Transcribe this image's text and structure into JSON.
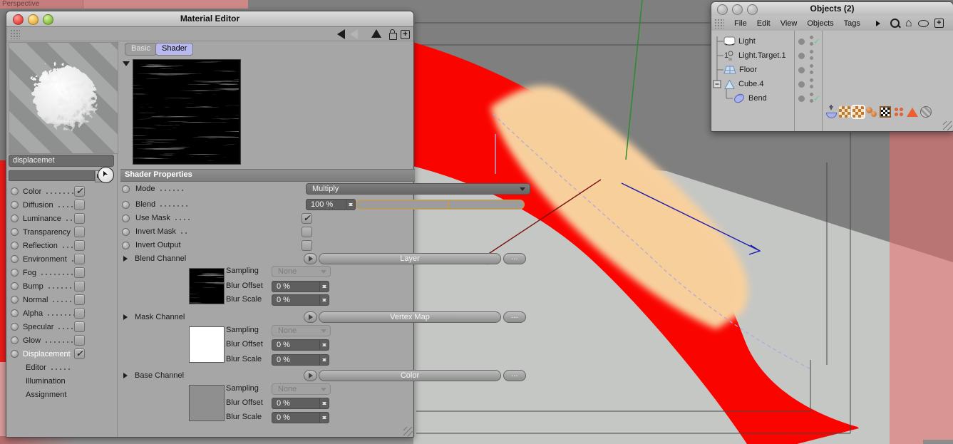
{
  "viewport": {
    "label": "Perspective",
    "scene_colors": {
      "band": "#fa0400",
      "band_highlight": "#f7cf9b",
      "axis_green": "#2f8a2f",
      "axis_red": "#7a1111",
      "axis_blue": "#1c1cae",
      "overlay_pink": "#e96c6c"
    }
  },
  "material_editor": {
    "title": "Material Editor",
    "name_value": "displacemet",
    "tabs": {
      "basic": "Basic",
      "shader": "Shader"
    },
    "channels": [
      {
        "label": "Color",
        "checked": true
      },
      {
        "label": "Diffusion",
        "checked": false
      },
      {
        "label": "Luminance",
        "checked": false
      },
      {
        "label": "Transparency",
        "checked": false
      },
      {
        "label": "Reflection",
        "checked": false
      },
      {
        "label": "Environment",
        "checked": false
      },
      {
        "label": "Fog",
        "checked": false
      },
      {
        "label": "Bump",
        "checked": false
      },
      {
        "label": "Normal",
        "checked": false
      },
      {
        "label": "Alpha",
        "checked": false
      },
      {
        "label": "Specular",
        "checked": false
      },
      {
        "label": "Glow",
        "checked": false
      },
      {
        "label": "Displacement",
        "checked": true,
        "selected": true
      },
      {
        "label": "Editor"
      },
      {
        "label": "Illumination"
      },
      {
        "label": "Assignment"
      }
    ],
    "props": {
      "header": "Shader Properties",
      "mode_label": "Mode",
      "mode_value": "Multiply",
      "blend_label": "Blend",
      "blend_value": "100 %",
      "use_mask_label": "Use Mask",
      "invert_mask_label": "Invert Mask",
      "invert_output_label": "Invert Output",
      "groups": [
        {
          "label": "Blend Channel",
          "button": "Layer",
          "more": "...",
          "sampling_label": "Sampling",
          "sampling_value": "None",
          "blur_offset_label": "Blur Offset",
          "blur_offset_value": "0 %",
          "blur_scale_label": "Blur Scale",
          "blur_scale_value": "0 %"
        },
        {
          "label": "Mask Channel",
          "button": "Vertex Map",
          "more": "...",
          "sampling_label": "Sampling",
          "sampling_value": "None",
          "blur_offset_label": "Blur Offset",
          "blur_offset_value": "0 %",
          "blur_scale_label": "Blur Scale",
          "blur_scale_value": "0 %"
        },
        {
          "label": "Base Channel",
          "button": "Color",
          "more": "...",
          "sampling_label": "Sampling",
          "sampling_value": "None",
          "blur_offset_label": "Blur Offset",
          "blur_offset_value": "0 %",
          "blur_scale_label": "Blur Scale",
          "blur_scale_value": "0 %"
        }
      ]
    }
  },
  "objects_panel": {
    "title": "Objects (2)",
    "menu": [
      {
        "label": "File"
      },
      {
        "label": "Edit"
      },
      {
        "label": "View"
      },
      {
        "label": "Objects"
      },
      {
        "label": "Tags"
      }
    ],
    "tree": [
      {
        "label": "Light",
        "enabled_check": true
      },
      {
        "label": "Light.Target.1"
      },
      {
        "label": "Floor"
      },
      {
        "label": "Cube.4",
        "expanded": true
      },
      {
        "label": "Bend",
        "enabled_check": true
      }
    ]
  }
}
